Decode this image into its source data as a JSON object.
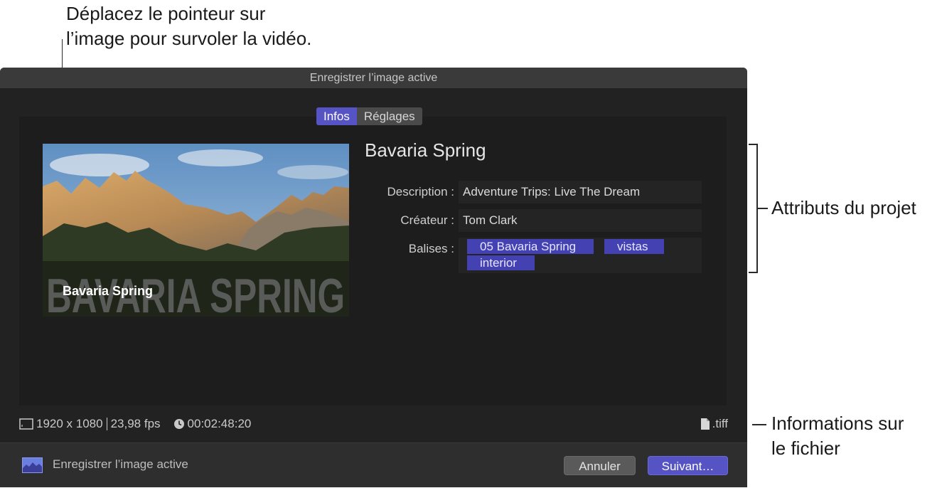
{
  "callouts": {
    "pointer_line1": "Déplacez le pointeur sur",
    "pointer_line2": "l’image pour survoler la vidéo.",
    "attributes": "Attributs du projet",
    "file_info_line1": "Informations sur",
    "file_info_line2": "le fichier"
  },
  "dialog": {
    "title": "Enregistrer l’image active",
    "tabs": [
      {
        "label": "Infos",
        "active": true
      },
      {
        "label": "Réglages",
        "active": false
      }
    ],
    "thumbnail": {
      "overlay_big": "BAVARIA SPRING",
      "overlay_small": "Bavaria Spring"
    },
    "project": {
      "title": "Bavaria Spring",
      "description_label": "Description :",
      "description_value": "Adventure Trips: Live The Dream",
      "creator_label": "Créateur :",
      "creator_value": "Tom Clark",
      "tags_label": "Balises :",
      "tags": [
        "05 Bavaria Spring",
        "vistas",
        "interior"
      ]
    },
    "status": {
      "resolution": "1920 x 1080",
      "fps": "23,98 fps",
      "timecode": "00:02:48:20",
      "file_ext": ".tiff"
    },
    "footer": {
      "label": "Enregistrer l’image active",
      "cancel": "Annuler",
      "next": "Suivant…"
    }
  },
  "colors": {
    "accent": "#5654c4",
    "tag": "#4442b2"
  }
}
